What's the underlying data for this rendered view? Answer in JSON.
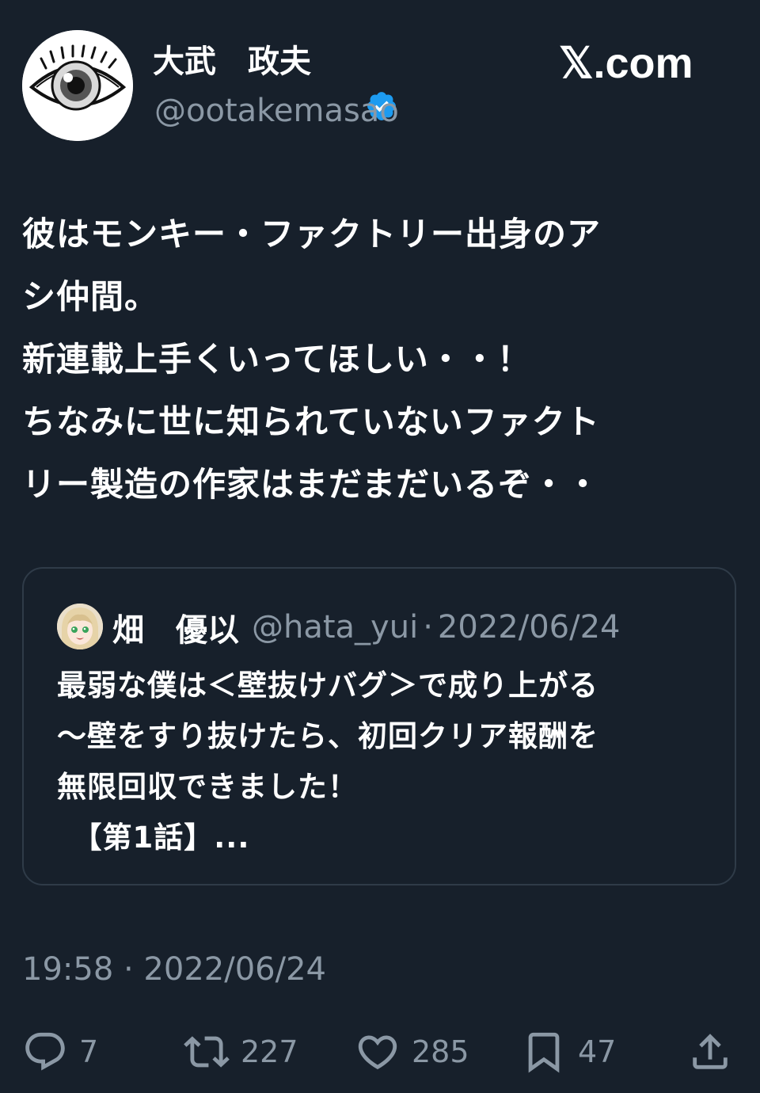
{
  "author": {
    "display_name": "大武　政夫",
    "handle": "@ootakemasao",
    "verified_icon": "verified-badge-icon"
  },
  "brand": {
    "site": "𝕏.com"
  },
  "tweet": {
    "text": "彼はモンキー・ファクトリー出身のア\nシ仲間。\n新連載上手くいってほしい・・！\nちなみに世に知られていないファクト\nリー製造の作家はまだまだいるぞ・・"
  },
  "quote": {
    "display_name": "畑　優以",
    "handle": "@hata_yui",
    "separator": "·",
    "date": "2022/06/24",
    "text": "最弱な僕は＜壁抜けバグ＞で成り上がる\n～壁をすり抜けたら、初回クリア報酬を\n無限回収できました！\n　【第1話】..."
  },
  "timestamp": "19:58 · 2022/06/24",
  "actions": {
    "replies": "7",
    "retweets": "227",
    "likes": "285",
    "bookmarks": "47"
  },
  "colors": {
    "background": "#17202b",
    "muted": "#8b98a5",
    "verified": "#1d9bf0",
    "border": "#2f3b48"
  }
}
